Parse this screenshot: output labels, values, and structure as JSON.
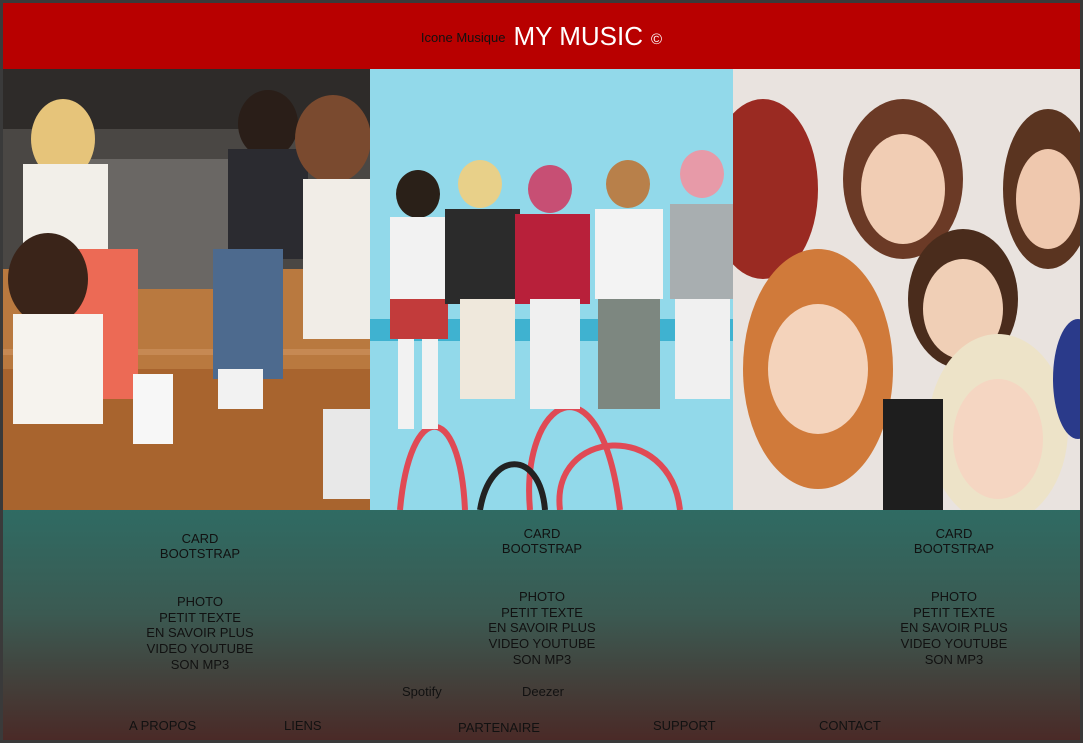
{
  "header": {
    "icon_label": "Icone Musique",
    "title": "MY MUSIC",
    "copyright": "©",
    "background": "#b80000"
  },
  "photos": [
    {
      "group": "group-1",
      "background": "#b07a4a"
    },
    {
      "group": "group-2",
      "background": "#8fd6e6"
    },
    {
      "group": "group-3",
      "background": "#e8e2de"
    }
  ],
  "cards": [
    {
      "title": "CARD BOOTSTRAP",
      "items": [
        "PHOTO",
        "PETIT TEXTE",
        "EN SAVOIR PLUS",
        "VIDEO YOUTUBE",
        "SON MP3"
      ]
    },
    {
      "title": "CARD BOOTSTRAP",
      "items": [
        "PHOTO",
        "PETIT TEXTE",
        "EN SAVOIR PLUS",
        "VIDEO YOUTUBE",
        "SON MP3"
      ]
    },
    {
      "title": "CARD BOOTSTRAP",
      "items": [
        "PHOTO",
        "PETIT TEXTE",
        "EN SAVOIR PLUS",
        "VIDEO YOUTUBE",
        "SON MP3"
      ]
    }
  ],
  "streaming": {
    "spotify": "Spotify",
    "deezer": "Deezer"
  },
  "footer": {
    "about": "A PROPOS",
    "links": "LIENS",
    "partners": "PARTENAIRE",
    "support": "SUPPORT",
    "contact": "CONTACT"
  }
}
